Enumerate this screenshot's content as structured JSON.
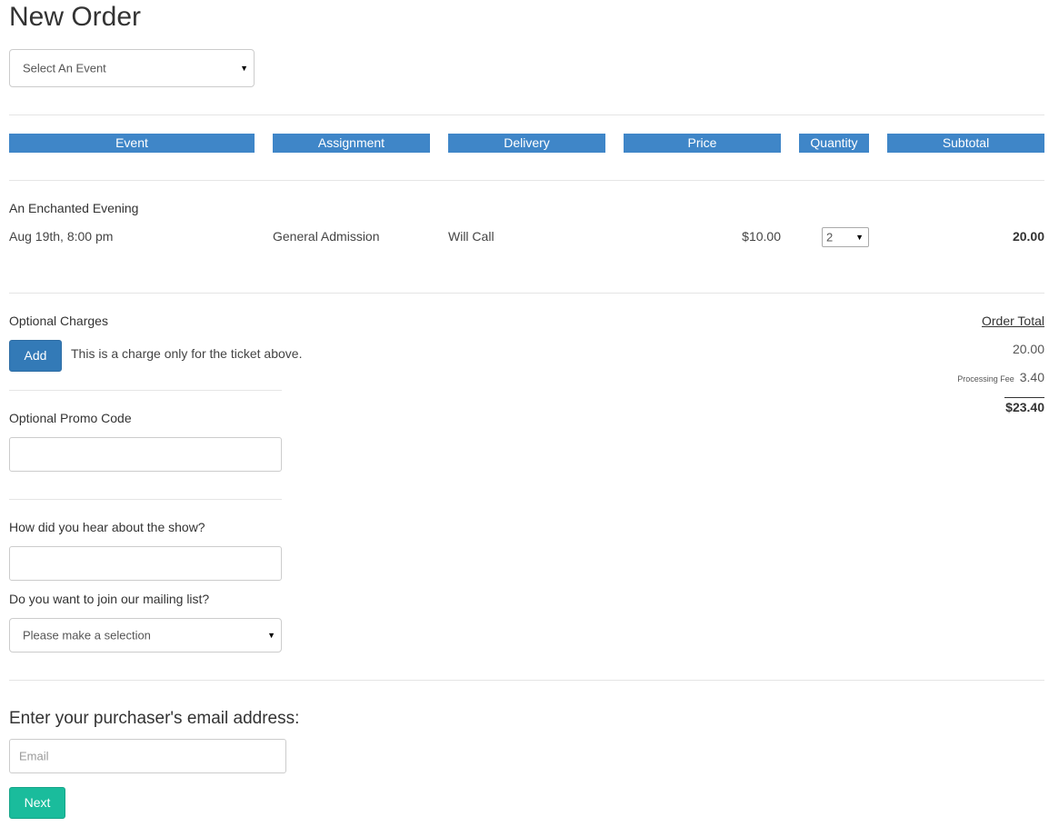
{
  "page": {
    "title": "New Order"
  },
  "event_select": {
    "value": "Select An Event"
  },
  "table": {
    "headers": [
      "Event",
      "Assignment",
      "Delivery",
      "Price",
      "Quantity",
      "Subtotal"
    ],
    "row": {
      "event_name": "An Enchanted Evening",
      "date": "Aug 19th, 8:00 pm",
      "assignment": "General Admission",
      "delivery": "Will Call",
      "price": "$10.00",
      "quantity": "2",
      "subtotal": "20.00"
    }
  },
  "optional_charges": {
    "label": "Optional Charges",
    "add_label": "Add",
    "description": "This is a charge only for the ticket above."
  },
  "order_total": {
    "label": "Order Total",
    "subtotal": "20.00",
    "fee_label": "Processing Fee",
    "fee": "3.40",
    "total": "$23.40"
  },
  "promo": {
    "label": "Optional Promo Code",
    "value": ""
  },
  "hear": {
    "label": "How did you hear about the show?",
    "value": ""
  },
  "mailing": {
    "label": "Do you want to join our mailing list?",
    "value": "Please make a selection"
  },
  "email": {
    "heading": "Enter your purchaser's email address:",
    "placeholder": "Email"
  },
  "next_label": "Next"
}
